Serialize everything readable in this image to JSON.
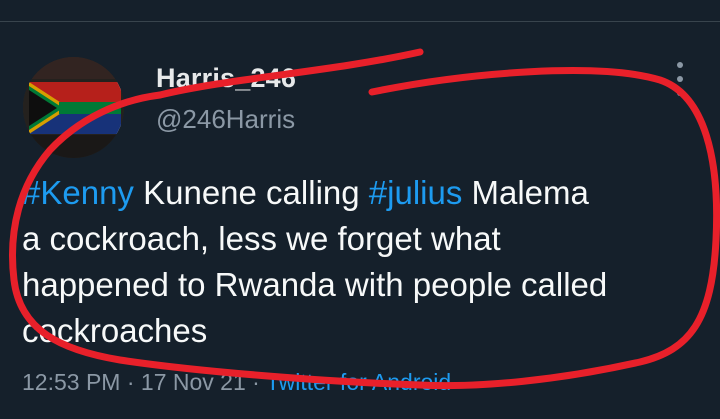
{
  "tweet": {
    "display_name": "Harris_246",
    "handle": "@246Harris",
    "text_lines": [
      [
        {
          "t": "#Kenny",
          "tag": true
        },
        {
          "t": " Kunene calling ",
          "tag": false
        },
        {
          "t": "#julius",
          "tag": true
        },
        {
          "t": "  Malema",
          "tag": false
        }
      ],
      [
        {
          "t": "a cockroach, less we forget what",
          "tag": false
        }
      ],
      [
        {
          "t": "happened to Rwanda with people called",
          "tag": false
        }
      ],
      [
        {
          "t": "cockroaches",
          "tag": false
        }
      ]
    ],
    "time": "12:53 PM",
    "separator": "·",
    "date": "17 Nov 21",
    "source": "Twitter for Android"
  },
  "colors": {
    "background": "#15202b",
    "link": "#1d9bf0",
    "secondary_text": "#8b98a5",
    "annotation": "#e8202a"
  },
  "icons": {
    "more": "vertical-ellipsis-icon",
    "avatar": "south-africa-flag-avatar"
  }
}
